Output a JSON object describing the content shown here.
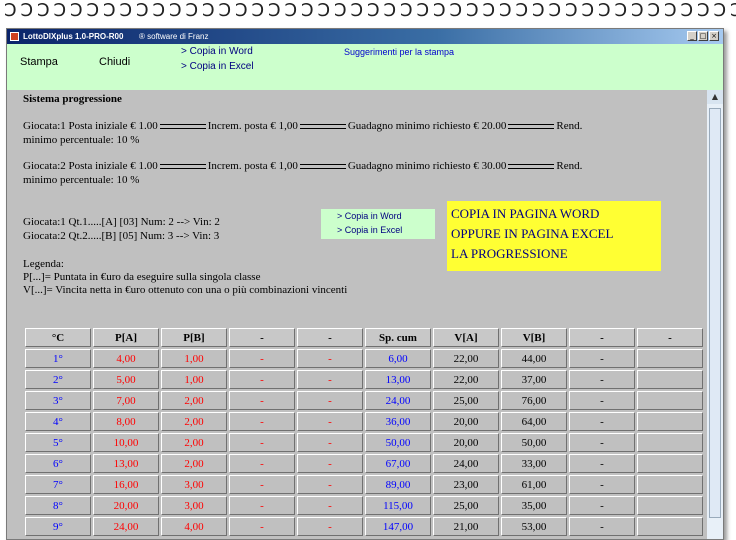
{
  "window": {
    "title": "LottoDIXplus 1.0-PRO-R00",
    "subtitle": "® software di Franz",
    "controls": [
      "_",
      "□",
      "×"
    ]
  },
  "menu": {
    "stampa": "Stampa",
    "chiudi": "Chiudi",
    "copy_word": "> Copia in Word",
    "copy_excel": "> Copia in Excel",
    "suggerimenti": "Suggerimenti per la stampa"
  },
  "content": {
    "heading": "Sistema progressione",
    "g1_posta": "Giocata:1 Posta iniziale € 1.00",
    "g1_incrrem": "Increm. posta € 1,00",
    "g1_guadagno": "Guadagno minimo richiesto € 20.00",
    "g1_rend": "Rend.",
    "g1_min": "minimo percentuale: 10 %",
    "g2_posta": "Giocata:2 Posta iniziale € 1.00",
    "g2_incrrem": "Increm. posta € 1,00",
    "g2_guadagno": "Guadagno minimo richiesto € 30.00",
    "g2_rend": "Rend.",
    "g2_min": "minimo percentuale: 10 %",
    "qt1": "Giocata:1 Qt.1.....[A] [03] Num: 2 --> Vin: 2",
    "qt2": "Giocata:2 Qt.2.....[B] [05] Num: 3 --> Vin: 3",
    "legend_title": "Legenda:",
    "legend_p": "P[...]= Puntata in €uro da eseguire sulla singola classe",
    "legend_v": "V[...]= Vincita netta in €uro ottenuto con una o più combinazioni vincenti"
  },
  "copybox": {
    "word": "> Copia in Word",
    "excel": "> Copia in Excel"
  },
  "note": {
    "line1": "COPIA IN PAGINA WORD",
    "line2": "OPPURE IN PAGINA EXCEL",
    "line3": "LA PROGRESSIONE"
  },
  "scroll_up_icon": "triangle-up",
  "table": {
    "headers": [
      "°C",
      "P[A]",
      "P[B]",
      "-",
      "-",
      "Sp. cum",
      "V[A]",
      "V[B]",
      "-",
      "-"
    ],
    "rows": [
      [
        "1°",
        "4,00",
        "1,00",
        "-",
        "-",
        "6,00",
        "22,00",
        "44,00",
        "-"
      ],
      [
        "2°",
        "5,00",
        "1,00",
        "-",
        "-",
        "13,00",
        "22,00",
        "37,00",
        "-"
      ],
      [
        "3°",
        "7,00",
        "2,00",
        "-",
        "-",
        "24,00",
        "25,00",
        "76,00",
        "-"
      ],
      [
        "4°",
        "8,00",
        "2,00",
        "-",
        "-",
        "36,00",
        "20,00",
        "64,00",
        "-"
      ],
      [
        "5°",
        "10,00",
        "2,00",
        "-",
        "-",
        "50,00",
        "20,00",
        "50,00",
        "-"
      ],
      [
        "6°",
        "13,00",
        "2,00",
        "-",
        "-",
        "67,00",
        "24,00",
        "33,00",
        "-"
      ],
      [
        "7°",
        "16,00",
        "3,00",
        "-",
        "-",
        "89,00",
        "23,00",
        "61,00",
        "-"
      ],
      [
        "8°",
        "20,00",
        "3,00",
        "-",
        "-",
        "115,00",
        "25,00",
        "35,00",
        "-"
      ],
      [
        "9°",
        "24,00",
        "4,00",
        "-",
        "-",
        "147,00",
        "21,00",
        "53,00",
        "-"
      ]
    ]
  }
}
